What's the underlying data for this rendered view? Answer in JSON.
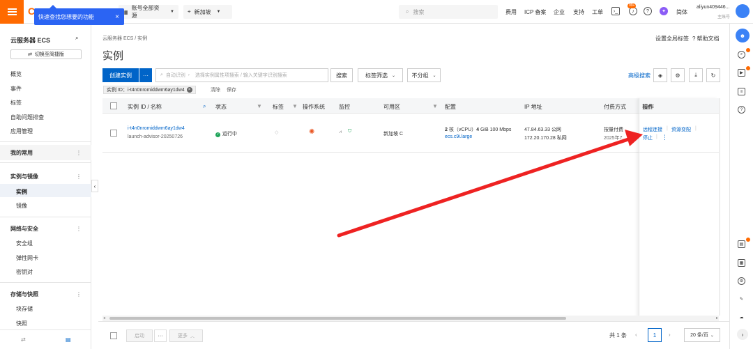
{
  "topbar": {
    "tooltip": "快速查找您想要的功能",
    "tooltip_close": "×",
    "resource_scope": "账号全部资源",
    "region": "新加坡",
    "search_placeholder": "搜索",
    "nav": [
      "费用",
      "ICP 备案",
      "企业",
      "支持",
      "工单"
    ],
    "notif_badge": "99+",
    "language": "简体",
    "account_name": "aliyun409446...",
    "account_role": "主账号"
  },
  "sidebar": {
    "title": "云服务器 ECS",
    "switch_label": "切换至简捷版",
    "top_items": [
      "概览",
      "事件",
      "标签",
      "自助问题排查",
      "应用管理"
    ],
    "groups": [
      {
        "label": "我的常用",
        "items": []
      },
      {
        "label": "实例与镜像",
        "items": [
          "实例",
          "镜像"
        ]
      },
      {
        "label": "网络与安全",
        "items": [
          "安全组",
          "弹性网卡",
          "密钥对"
        ]
      },
      {
        "label": "存储与快照",
        "items": [
          "块存储",
          "快照"
        ]
      }
    ]
  },
  "main": {
    "breadcrumb": "云服务器 ECS  /  实例",
    "title": "实例",
    "set_tags": "设置全局标签",
    "help": "帮助文档",
    "create_btn": "创建实例",
    "more_btn": "···",
    "search_type": "自动识别",
    "search_placeholder": "选择实例属性项搜索 / 输入关键字识别搜索",
    "search_btn": "搜索",
    "tag_filter": "标签筛选",
    "group_select": "不分组",
    "advanced_search": "高级搜索",
    "filter_chip": "实例 ID：i-t4n0nromiddwm6ay1dw4",
    "clear": "清除",
    "save": "保存"
  },
  "table": {
    "headers": [
      "实例 ID / 名称",
      "状态",
      "标签",
      "操作系统",
      "监控",
      "可用区",
      "配置",
      "IP 地址",
      "付费方式",
      "操作"
    ],
    "rows": [
      {
        "instance_id": "i-t4n0nromiddwm6ay1dw4",
        "name": "launch-advisor-20250726",
        "status": "运行中",
        "zone": "新加坡 C",
        "spec": "2 核（vCPU）4 GiB 100 Mbps",
        "spec_cores": "2",
        "spec_mem": "4",
        "instance_type": "ecs.c9i.large",
        "public_ip": "47.84.63.33 公网",
        "private_ip": "172.20.170.28 私网",
        "billing": "按量付费",
        "billing_date": "2025年7...",
        "actions": [
          "远程连接",
          "资源变配",
          "停止"
        ]
      }
    ]
  },
  "footer": {
    "start_btn": "启动",
    "more_btn": "···",
    "more_label": "更多",
    "total": "共 1 条",
    "page": "1",
    "page_size": "20 条/页"
  },
  "colors": {
    "brand": "#ff6a00",
    "primary": "#0064c8",
    "tooltip": "#2b64f3",
    "annotation_arrow": "#ee2222",
    "running": "#20a45a"
  }
}
